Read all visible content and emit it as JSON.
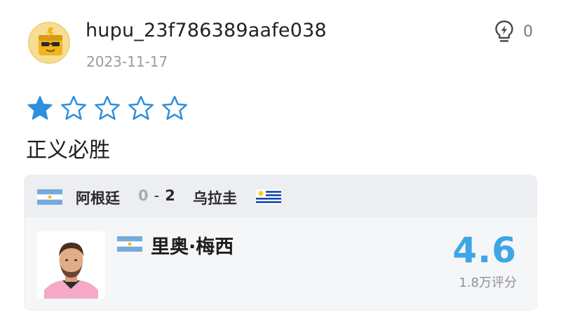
{
  "review": {
    "username": "hupu_23f786389aafe038",
    "date": "2023-11-17",
    "like_count": "0",
    "stars_total": 5,
    "stars_filled": 1,
    "comment": "正义必胜"
  },
  "match": {
    "home_team": "阿根廷",
    "home_score": "0",
    "separator": "-",
    "away_score": "2",
    "away_team": "乌拉圭"
  },
  "player": {
    "name": "里奥·梅西",
    "rating": "4.6",
    "rating_count": "1.8万评分"
  },
  "colors": {
    "star_filled": "#2e8fdc",
    "star_outline": "#2e8fdc",
    "rating": "#3ea6e4",
    "card_bg": "#f5f6f8",
    "header_bg": "#eceef1"
  },
  "icons": {
    "avatar": "hupu-avatar-icon",
    "like": "lightbulb-icon",
    "star_filled": "star-filled-icon",
    "star_empty": "star-outline-icon",
    "argentina_flag": "argentina-flag-icon",
    "uruguay_flag": "uruguay-flag-icon"
  }
}
